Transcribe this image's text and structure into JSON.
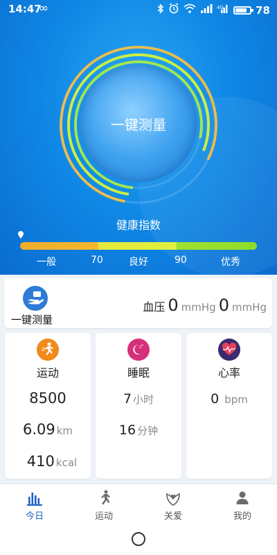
{
  "status_bar": {
    "time": "14:47",
    "infinity": "∞",
    "battery_level": "78",
    "icons": [
      "bluetooth-icon",
      "alarm-icon",
      "wifi-icon",
      "signal-icon",
      "signal-4g-icon",
      "battery-icon"
    ]
  },
  "hero": {
    "measure_button": "一键测量",
    "health_index_label": "健康指数",
    "scale": {
      "labels": [
        "一般",
        "70",
        "良好",
        "90",
        "优秀"
      ],
      "colors": [
        "#f0ad2a",
        "#e4e83b",
        "#8ddc2a"
      ]
    }
  },
  "measure_card": {
    "label": "一键测量",
    "bp_label": "血压",
    "systolic": "0",
    "diastolic": "0",
    "unit": "mmHg"
  },
  "stats": {
    "sport": {
      "title": "运动",
      "steps": "8500",
      "distance": "6.09",
      "distance_unit": "km",
      "calories": "410",
      "calories_unit": "kcal",
      "icon_color": "#f08a1d"
    },
    "sleep": {
      "title": "睡眠",
      "hours": "7",
      "hours_unit": "小时",
      "minutes": "16",
      "minutes_unit": "分钟",
      "icon_color": "#d6307a"
    },
    "heart": {
      "title": "心率",
      "bpm": "0",
      "bpm_unit": "bpm",
      "icon_color": "#3a2b6e"
    }
  },
  "nav": {
    "items": [
      {
        "label": "今日",
        "icon": "chart-bars-icon",
        "active": true
      },
      {
        "label": "运动",
        "icon": "runner-icon",
        "active": false
      },
      {
        "label": "关爱",
        "icon": "care-icon",
        "active": false
      },
      {
        "label": "我的",
        "icon": "person-icon",
        "active": false
      }
    ],
    "active_color": "#1f63c6"
  }
}
